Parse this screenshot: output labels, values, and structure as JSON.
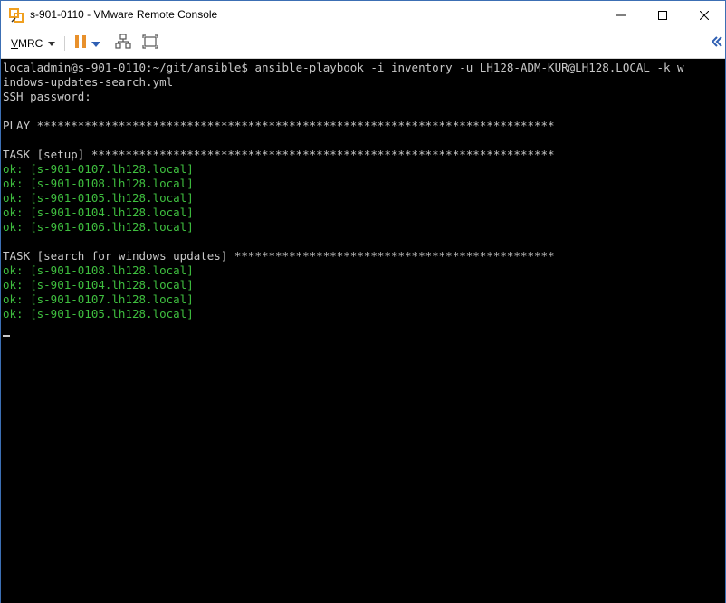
{
  "window": {
    "title": "s-901-0110 - VMware Remote Console"
  },
  "toolbar": {
    "vmrc_label_underlined": "V",
    "vmrc_label_rest": "MRC"
  },
  "console": {
    "lines": [
      {
        "text": "localadmin@s-901-0110:~/git/ansible$ ansible-playbook -i inventory -u LH128-ADM-KUR@LH128.LOCAL -k w",
        "style": "normal"
      },
      {
        "text": "indows-updates-search.yml",
        "style": "normal"
      },
      {
        "text": "SSH password:",
        "style": "normal"
      },
      {
        "text": "",
        "style": "normal"
      },
      {
        "text": "PLAY ****************************************************************************",
        "style": "normal"
      },
      {
        "text": "",
        "style": "normal"
      },
      {
        "text": "TASK [setup] ********************************************************************",
        "style": "normal"
      },
      {
        "text": "ok: [s-901-0107.lh128.local]",
        "style": "ok"
      },
      {
        "text": "ok: [s-901-0108.lh128.local]",
        "style": "ok"
      },
      {
        "text": "ok: [s-901-0105.lh128.local]",
        "style": "ok"
      },
      {
        "text": "ok: [s-901-0104.lh128.local]",
        "style": "ok"
      },
      {
        "text": "ok: [s-901-0106.lh128.local]",
        "style": "ok"
      },
      {
        "text": "",
        "style": "normal"
      },
      {
        "text": "TASK [search for windows updates] ***********************************************",
        "style": "normal"
      },
      {
        "text": "ok: [s-901-0108.lh128.local]",
        "style": "ok"
      },
      {
        "text": "ok: [s-901-0104.lh128.local]",
        "style": "ok"
      },
      {
        "text": "ok: [s-901-0107.lh128.local]",
        "style": "ok"
      },
      {
        "text": "ok: [s-901-0105.lh128.local]",
        "style": "ok"
      }
    ]
  },
  "colors": {
    "console_bg": "#000000",
    "console_text": "#c8c8c8",
    "ok_text": "#3fbf3f",
    "pause_accent": "#e8902b",
    "toolbar_accent": "#2f5fb3"
  },
  "icons": {
    "app": "vmware-app-icon",
    "minimize": "minimize-icon",
    "maximize": "maximize-icon",
    "close": "close-icon",
    "pause": "pause-icon",
    "network": "network-icon",
    "fullscreen": "fullscreen-icon",
    "collapse": "double-chevron-left-icon"
  }
}
